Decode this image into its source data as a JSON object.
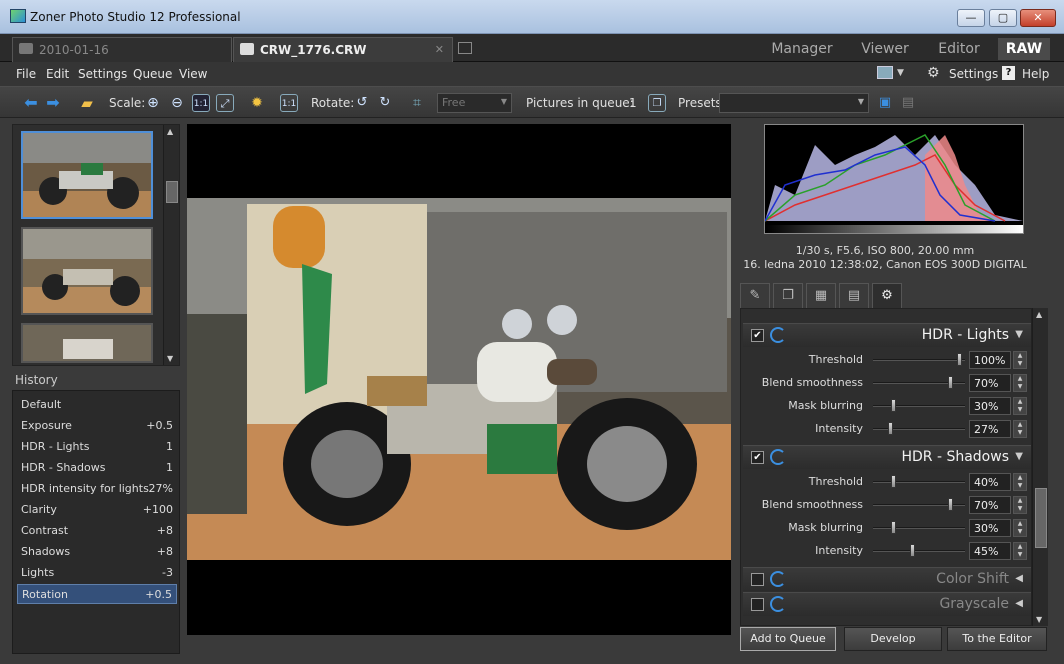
{
  "window": {
    "title": "Zoner Photo Studio 12 Professional",
    "minimize": "—",
    "maximize": "▢",
    "close": "✕"
  },
  "tabs": {
    "folder_tab": "2010-01-16",
    "file_tab": "CRW_1776.CRW",
    "close_glyph": "✕"
  },
  "modes": {
    "manager": "Manager",
    "viewer": "Viewer",
    "editor": "Editor",
    "raw": "RAW"
  },
  "menu": {
    "file": "File",
    "edit": "Edit",
    "settings": "Settings",
    "queue": "Queue",
    "view": "View",
    "right_settings": "Settings",
    "help": "Help"
  },
  "toolbar": {
    "scale_label": "Scale:",
    "fit_1_1": "1:1",
    "rotate_label": "Rotate:",
    "crop_select": "Free",
    "queue_label": "Pictures in queue:",
    "queue_count": "1",
    "presets_label": "Presets:",
    "presets_value": ""
  },
  "history": {
    "header": "History",
    "rows": [
      {
        "name": "Default",
        "value": ""
      },
      {
        "name": "Exposure",
        "value": "+0.5"
      },
      {
        "name": "HDR - Lights",
        "value": "1"
      },
      {
        "name": "HDR - Shadows",
        "value": "1"
      },
      {
        "name": "HDR intensity for lights",
        "value": "27%"
      },
      {
        "name": "Clarity",
        "value": "+100"
      },
      {
        "name": "Contrast",
        "value": "+8"
      },
      {
        "name": "Shadows",
        "value": "+8"
      },
      {
        "name": "Lights",
        "value": "-3"
      },
      {
        "name": "Rotation",
        "value": "+0.5"
      }
    ]
  },
  "exif": {
    "line1": "1/30 s, F5.6, ISO 800, 20.00 mm",
    "line2": "16. ledna 2010 12:38:02, Canon EOS 300D DIGITAL"
  },
  "sections": {
    "hdr_lights": {
      "title": "HDR - Lights",
      "checked": "✔",
      "params": [
        {
          "label": "Threshold",
          "value": "100%",
          "level": 0.95
        },
        {
          "label": "Blend smoothness",
          "value": "70%",
          "level": 0.85
        },
        {
          "label": "Mask blurring",
          "value": "30%",
          "level": 0.2
        },
        {
          "label": "Intensity",
          "value": "27%",
          "level": 0.17
        }
      ]
    },
    "hdr_shadows": {
      "title": "HDR - Shadows",
      "checked": "✔",
      "params": [
        {
          "label": "Threshold",
          "value": "40%",
          "level": 0.2
        },
        {
          "label": "Blend smoothness",
          "value": "70%",
          "level": 0.85
        },
        {
          "label": "Mask blurring",
          "value": "30%",
          "level": 0.2
        },
        {
          "label": "Intensity",
          "value": "45%",
          "level": 0.42
        }
      ]
    },
    "color_shift": {
      "title": "Color Shift"
    },
    "grayscale": {
      "title": "Grayscale"
    }
  },
  "buttons": {
    "add_to_queue": "Add to Queue",
    "develop": "Develop",
    "to_editor": "To the Editor"
  },
  "colors": {
    "accent": "#3b8fe0",
    "selected_row": "#34507a"
  }
}
